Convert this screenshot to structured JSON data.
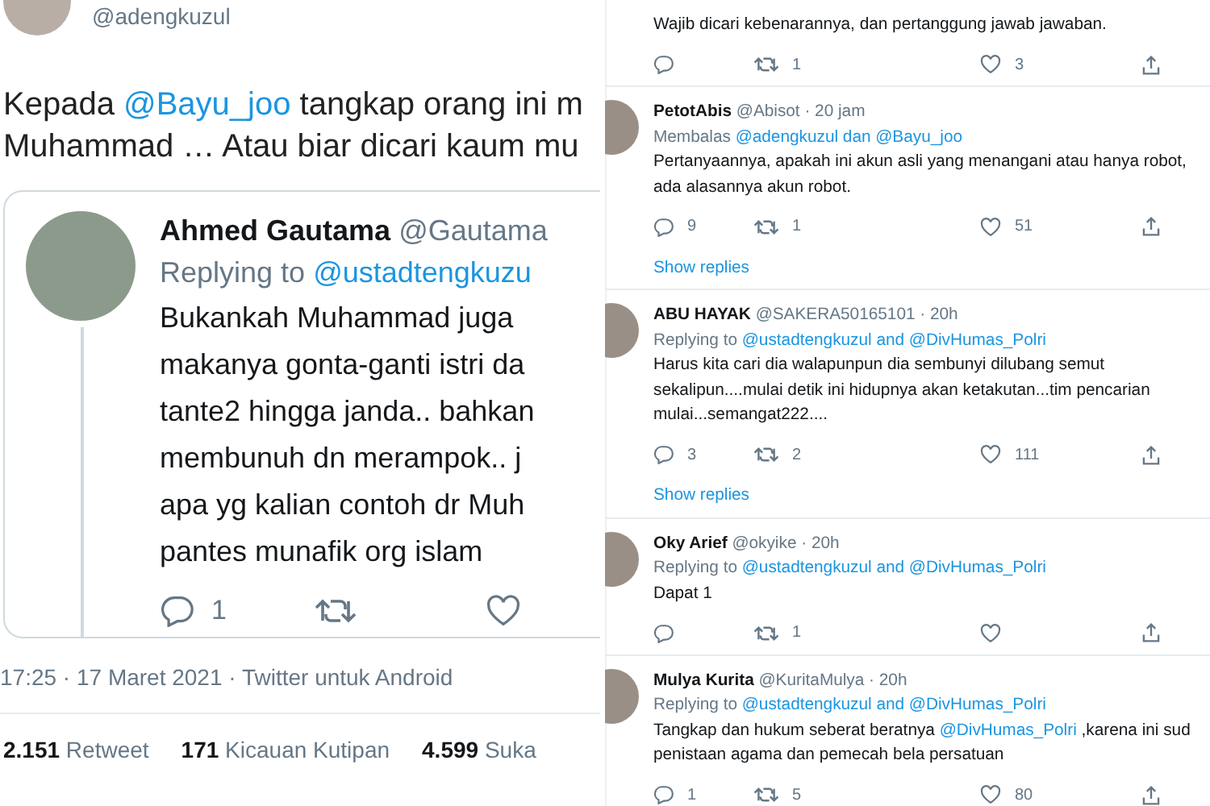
{
  "main_tweet": {
    "handle": "@adengkuzul",
    "lines": [
      [
        {
          "kind": "text",
          "text": "Kepada "
        },
        {
          "kind": "mention",
          "text": "@Bayu_joo"
        },
        {
          "kind": "text",
          "text": " tangkap orang ini m"
        }
      ],
      [
        {
          "kind": "text",
          "text": "Muhammad … Atau biar dicari kaum mu"
        }
      ]
    ],
    "quoted": {
      "name": "Ahmed Gautama",
      "handle": "@Gautama",
      "replying_prefix": "Replying to",
      "replying_to": "@ustadtengkuzu",
      "lines": [
        "Bukankah Muhammad juga",
        "makanya gonta-ganti istri da",
        "tante2 hingga janda.. bahkan",
        "membunuh dn merampok.. j",
        "apa yg kalian contoh dr Muh",
        "pantes munafik org islam"
      ],
      "reply_count": "1"
    },
    "timestamp": "17:25 · 17 Maret 2021 · Twitter untuk Android",
    "stats": [
      {
        "count": "2.151",
        "label": "Retweet"
      },
      {
        "count": "171",
        "label": "Kicauan Kutipan"
      },
      {
        "count": "4.599",
        "label": "Suka"
      }
    ]
  },
  "replies": [
    {
      "lines": [
        [
          {
            "kind": "text",
            "text": "Wajib dicari kebenarannya, dan pertanggung jawab jawaban."
          }
        ]
      ],
      "retweets": "1",
      "likes": "3"
    },
    {
      "name": "PetotAbis",
      "handle": "@Abisot · 20 jam",
      "replying_prefix": "Membalas",
      "replying_to": "@adengkuzul dan @Bayu_joo",
      "lines": [
        [
          {
            "kind": "text",
            "text": "Pertanyaannya, apakah ini akun asli yang menangani atau hanya robot,"
          }
        ],
        [
          {
            "kind": "text",
            "text": "ada alasannya akun robot."
          }
        ]
      ],
      "replies": "9",
      "retweets": "1",
      "likes": "51",
      "show_replies": "Show replies"
    },
    {
      "name": "ABU HAYAK",
      "handle": "@SAKERA50165101 · 20h",
      "replying_prefix": "Replying to",
      "replying_to": "@ustadtengkuzul and @DivHumas_Polri",
      "lines": [
        [
          {
            "kind": "text",
            "text": "Harus kita cari dia walapunpun dia sembunyi dilubang semut"
          }
        ],
        [
          {
            "kind": "text",
            "text": "sekalipun....mulai detik ini hidupnya akan ketakutan...tim pencarian"
          }
        ],
        [
          {
            "kind": "text",
            "text": "mulai...semangat222...."
          }
        ]
      ],
      "replies": "3",
      "retweets": "2",
      "likes": "111",
      "show_replies": "Show replies"
    },
    {
      "name": "Oky Arief",
      "handle": "@okyike · 20h",
      "replying_prefix": "Replying to",
      "replying_to": "@ustadtengkuzul and @DivHumas_Polri",
      "lines": [
        [
          {
            "kind": "text",
            "text": "Dapat 1"
          }
        ]
      ],
      "retweets": "1"
    },
    {
      "name": "Mulya Kurita",
      "handle": "@KuritaMulya · 20h",
      "replying_prefix": "Replying to",
      "replying_to": "@ustadtengkuzul and @DivHumas_Polri",
      "lines": [
        [
          {
            "kind": "text",
            "text": "Tangkap dan hukum seberat beratnya "
          },
          {
            "kind": "mention",
            "text": "@DivHumas_Polri"
          },
          {
            "kind": "text",
            "text": " ,karena ini sud"
          }
        ],
        [
          {
            "kind": "text",
            "text": "penistaan agama dan pemecah bela persatuan"
          }
        ]
      ],
      "replies": "1",
      "retweets": "5",
      "likes": "80"
    }
  ]
}
